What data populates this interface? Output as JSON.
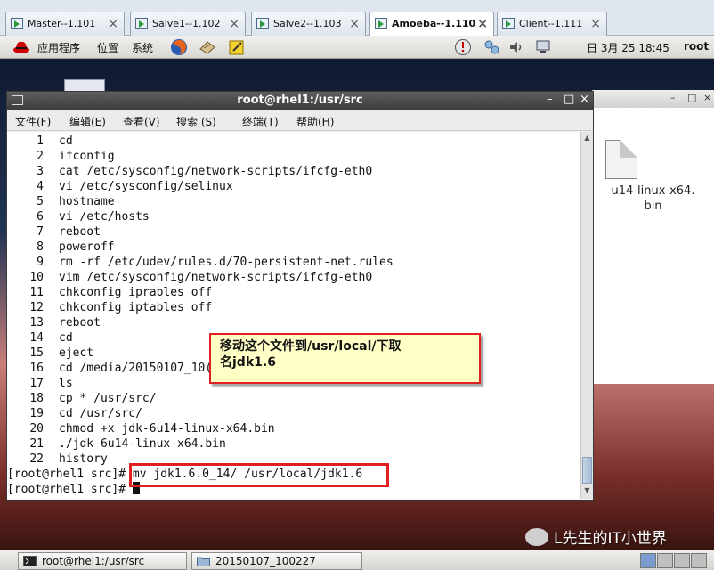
{
  "vm_tabs": [
    {
      "label": "Master--1.101"
    },
    {
      "label": "Salve1--1.102"
    },
    {
      "label": "Salve2--1.103"
    },
    {
      "label": "Amoeba--1.110"
    },
    {
      "label": "Client--1.111"
    }
  ],
  "active_tab": "Amoeba--1.110",
  "top_panel": {
    "applications": "应用程序",
    "places": "位置",
    "system": "系统",
    "datetime": "日 3月 25 18:45",
    "user": "root"
  },
  "desktop": {
    "file_label_line1": "u14-linux-x64.",
    "file_label_line2": "bin"
  },
  "terminal": {
    "title": "root@rhel1:/usr/src",
    "menu": [
      "文件(F)",
      "编辑(E)",
      "查看(V)",
      "搜索 (S)",
      "终端(T)",
      "帮助(H)"
    ],
    "history": [
      {
        "n": "1",
        "cmd": "cd"
      },
      {
        "n": "2",
        "cmd": "ifconfig"
      },
      {
        "n": "3",
        "cmd": "cat /etc/sysconfig/network-scripts/ifcfg-eth0"
      },
      {
        "n": "4",
        "cmd": "vi /etc/sysconfig/selinux"
      },
      {
        "n": "5",
        "cmd": "hostname"
      },
      {
        "n": "6",
        "cmd": "vi /etc/hosts"
      },
      {
        "n": "7",
        "cmd": "reboot"
      },
      {
        "n": "8",
        "cmd": "poweroff"
      },
      {
        "n": "9",
        "cmd": "rm -rf /etc/udev/rules.d/70-persistent-net.rules"
      },
      {
        "n": "10",
        "cmd": "vim /etc/sysconfig/network-scripts/ifcfg-eth0"
      },
      {
        "n": "11",
        "cmd": "chkconfig iprables off"
      },
      {
        "n": "12",
        "cmd": "chkconfig iptables off"
      },
      {
        "n": "13",
        "cmd": "reboot"
      },
      {
        "n": "14",
        "cmd": "cd"
      },
      {
        "n": "15",
        "cmd": "eject"
      },
      {
        "n": "16",
        "cmd": "cd /media/20150107_10("
      },
      {
        "n": "17",
        "cmd": "ls"
      },
      {
        "n": "18",
        "cmd": "cp * /usr/src/"
      },
      {
        "n": "19",
        "cmd": "cd /usr/src/"
      },
      {
        "n": "20",
        "cmd": "chmod +x jdk-6u14-linux-x64.bin"
      },
      {
        "n": "21",
        "cmd": "./jdk-6u14-linux-x64.bin"
      },
      {
        "n": "22",
        "cmd": "history"
      }
    ],
    "prompt1": "[root@rhel1 src]#",
    "command1": " mv jdk1.6.0_14/ /usr/local/jdk1.6",
    "prompt2": "[root@rhel1 src]#"
  },
  "callout": {
    "line1": "移动这个文件到/usr/local/下取",
    "line2": "名jdk1.6"
  },
  "watermark": "L先生的IT小世界",
  "taskbar": {
    "terminal_item": "root@rhel1:/usr/src",
    "folder_item": "20150107_100227"
  },
  "colors": {
    "annotation_red": "#e02020",
    "callout_bg": "#ffffc6"
  }
}
